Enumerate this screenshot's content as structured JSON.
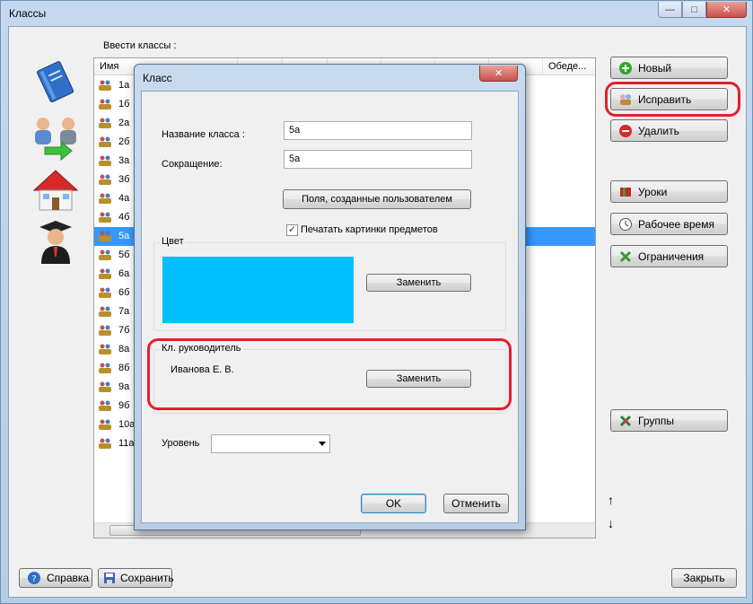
{
  "window": {
    "title": "Классы"
  },
  "main": {
    "classes_label": "Ввести классы :",
    "columns": [
      "Имя",
      "",
      "",
      "",
      "",
      "",
      "",
      "Обеде..."
    ],
    "rows": [
      "1а",
      "1б",
      "2а",
      "2б",
      "3а",
      "3б",
      "4а",
      "4б",
      "5а",
      "5б",
      "6а",
      "6б",
      "7а",
      "7б",
      "8а",
      "8б",
      "9а",
      "9б",
      "10а",
      "11а"
    ],
    "selected_row": "5а"
  },
  "right_buttons": {
    "new": "Новый",
    "edit": "Исправить",
    "delete": "Удалить",
    "lessons": "Уроки",
    "work_time": "Рабочее время",
    "constraints": "Ограничения",
    "groups": "Группы"
  },
  "bottom_buttons": {
    "help": "Справка",
    "save": "Сохранить",
    "close": "Закрыть"
  },
  "dialog": {
    "title": "Класс",
    "name_label": "Название класса :",
    "name_value": "5а",
    "abbr_label": "Сокращение:",
    "abbr_value": "5а",
    "user_fields_button": "Поля, созданные пользователем",
    "print_pictures_label": "Печатать картинки предметов",
    "print_pictures_checked": true,
    "color_group_title": "Цвет",
    "color_value": "#00c0ff",
    "color_replace": "Заменить",
    "teacher_group_title": "Кл. руководитель",
    "teacher_name": "Иванова Е. В.",
    "teacher_replace": "Заменить",
    "level_label": "Уровень",
    "level_value": "",
    "ok": "OK",
    "cancel": "Отменить"
  },
  "colors": {
    "highlight": "#e3202a",
    "selection": "#3399ff"
  }
}
